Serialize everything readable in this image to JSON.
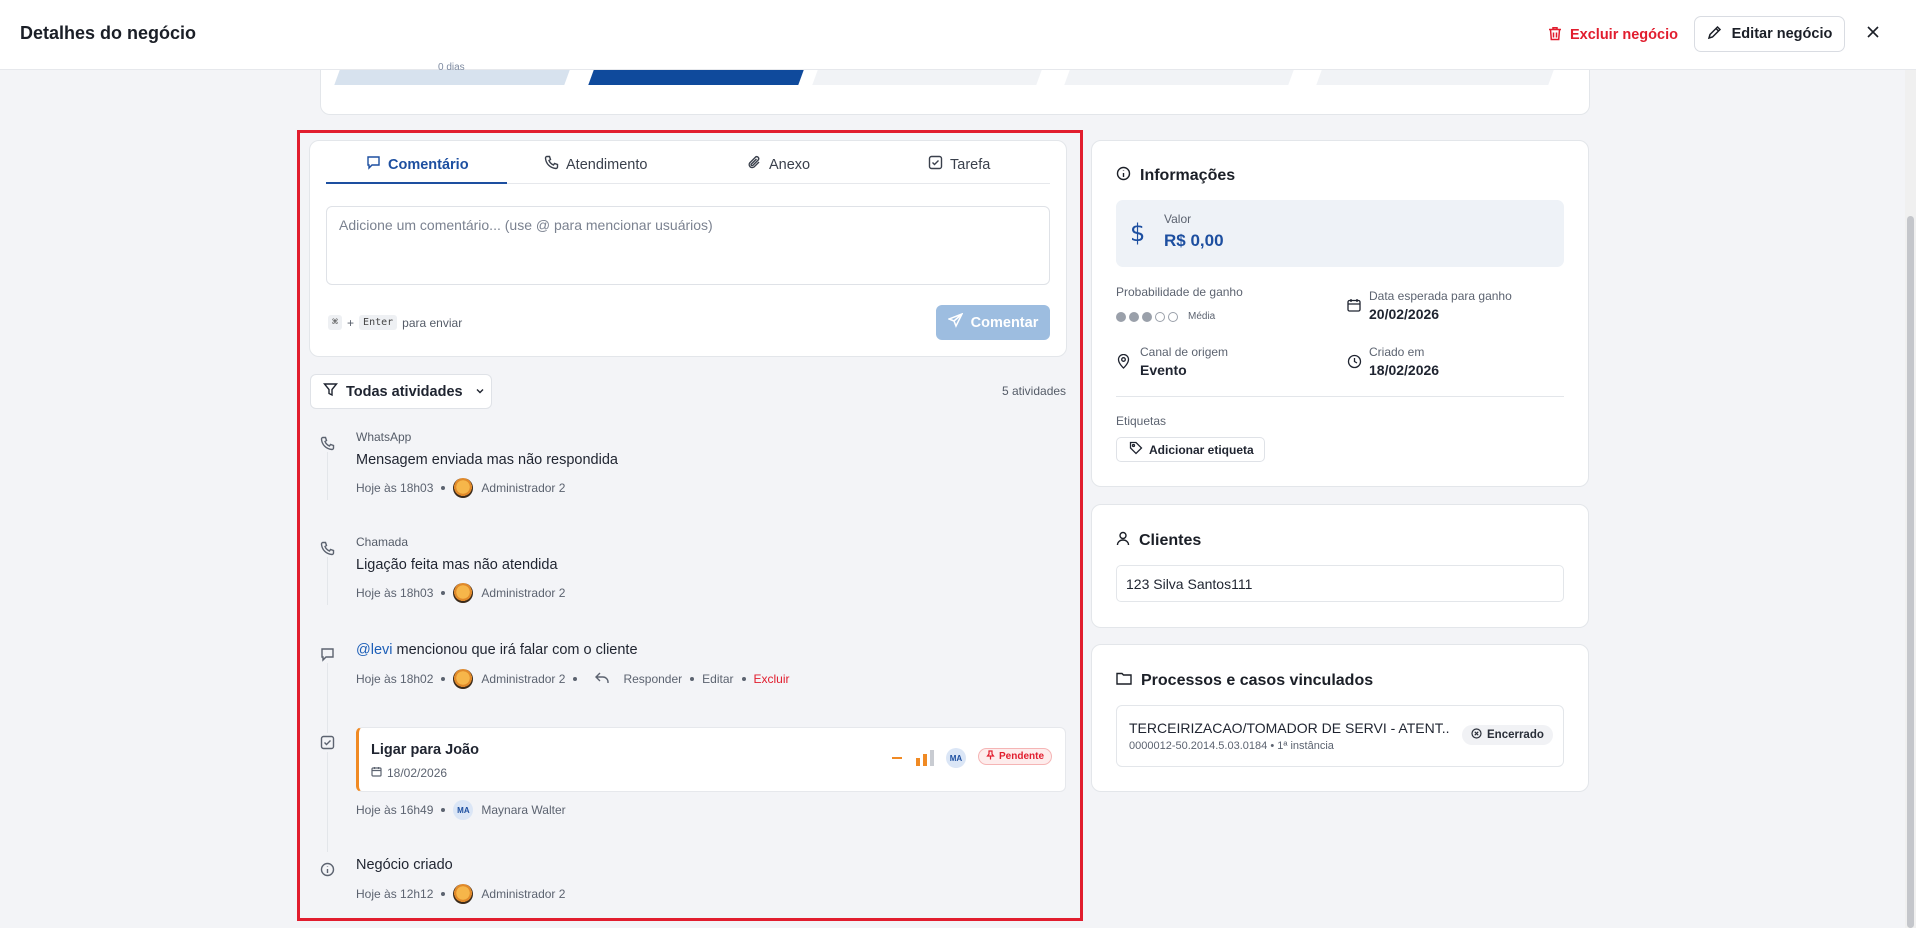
{
  "header": {
    "title": "Detalhes do negócio",
    "delete_label": "Excluir negócio",
    "edit_label": "Editar negócio"
  },
  "pipeline": {
    "first_stage_text": "0 dias"
  },
  "composer": {
    "tabs": [
      {
        "label": "Comentário",
        "icon": "message-icon"
      },
      {
        "label": "Atendimento",
        "icon": "phone-icon"
      },
      {
        "label": "Anexo",
        "icon": "paperclip-icon"
      },
      {
        "label": "Tarefa",
        "icon": "checkbox-icon"
      }
    ],
    "placeholder": "Adicione um comentário... (use @ para mencionar usuários)",
    "hint_key1": "⌘",
    "hint_plus": "+",
    "hint_key2": "Enter",
    "hint_text": "para enviar",
    "submit_label": "Comentar"
  },
  "activities": {
    "filter_label": "Todas atividades",
    "count_label": "5 atividades",
    "items": [
      {
        "type": "WhatsApp",
        "text": "Mensagem enviada mas não respondida",
        "time": "Hoje às 18h03",
        "author": "Administrador 2"
      },
      {
        "type": "Chamada",
        "text": "Ligação feita mas não atendida",
        "time": "Hoje às 18h03",
        "author": "Administrador 2"
      },
      {
        "mention": "@levi",
        "text": "mencionou que irá falar com o cliente",
        "time": "Hoje às 18h02",
        "author": "Administrador 2",
        "reply": "Responder",
        "edit": "Editar",
        "delete": "Excluir"
      },
      {
        "task_title": "Ligar para João",
        "task_date": "18/02/2026",
        "status": "Pendente",
        "assignee_initials": "MA",
        "time": "Hoje às 16h49",
        "author": "Maynara Walter"
      },
      {
        "text": "Negócio criado",
        "time": "Hoje às 12h12",
        "author": "Administrador 2"
      }
    ]
  },
  "info": {
    "title": "Informações",
    "value_label": "Valor",
    "value": "R$ 0,00",
    "prob_label": "Probabilidade de ganho",
    "prob_level": 3,
    "prob_max": 5,
    "prob_text": "Média",
    "expected_label": "Data esperada para ganho",
    "expected_value": "20/02/2026",
    "channel_label": "Canal de origem",
    "channel_value": "Evento",
    "created_label": "Criado em",
    "created_value": "18/02/2026",
    "tags_label": "Etiquetas",
    "add_tag_label": "Adicionar etiqueta"
  },
  "clients": {
    "title": "Clientes",
    "items": [
      "123 Silva Santos111"
    ]
  },
  "processes": {
    "title": "Processos e casos vinculados",
    "items": [
      {
        "title": "TERCEIRIZACAO/TOMADOR DE SERVI - ATENT...",
        "number": "0000012-50.2014.5.03.0184",
        "instance": "1ª instância",
        "status": "Encerrado"
      }
    ]
  },
  "colors": {
    "accent": "#1d4fa0",
    "danger": "#e11d2e",
    "task_border": "#f08a24",
    "highlight": "#e11d2e"
  }
}
